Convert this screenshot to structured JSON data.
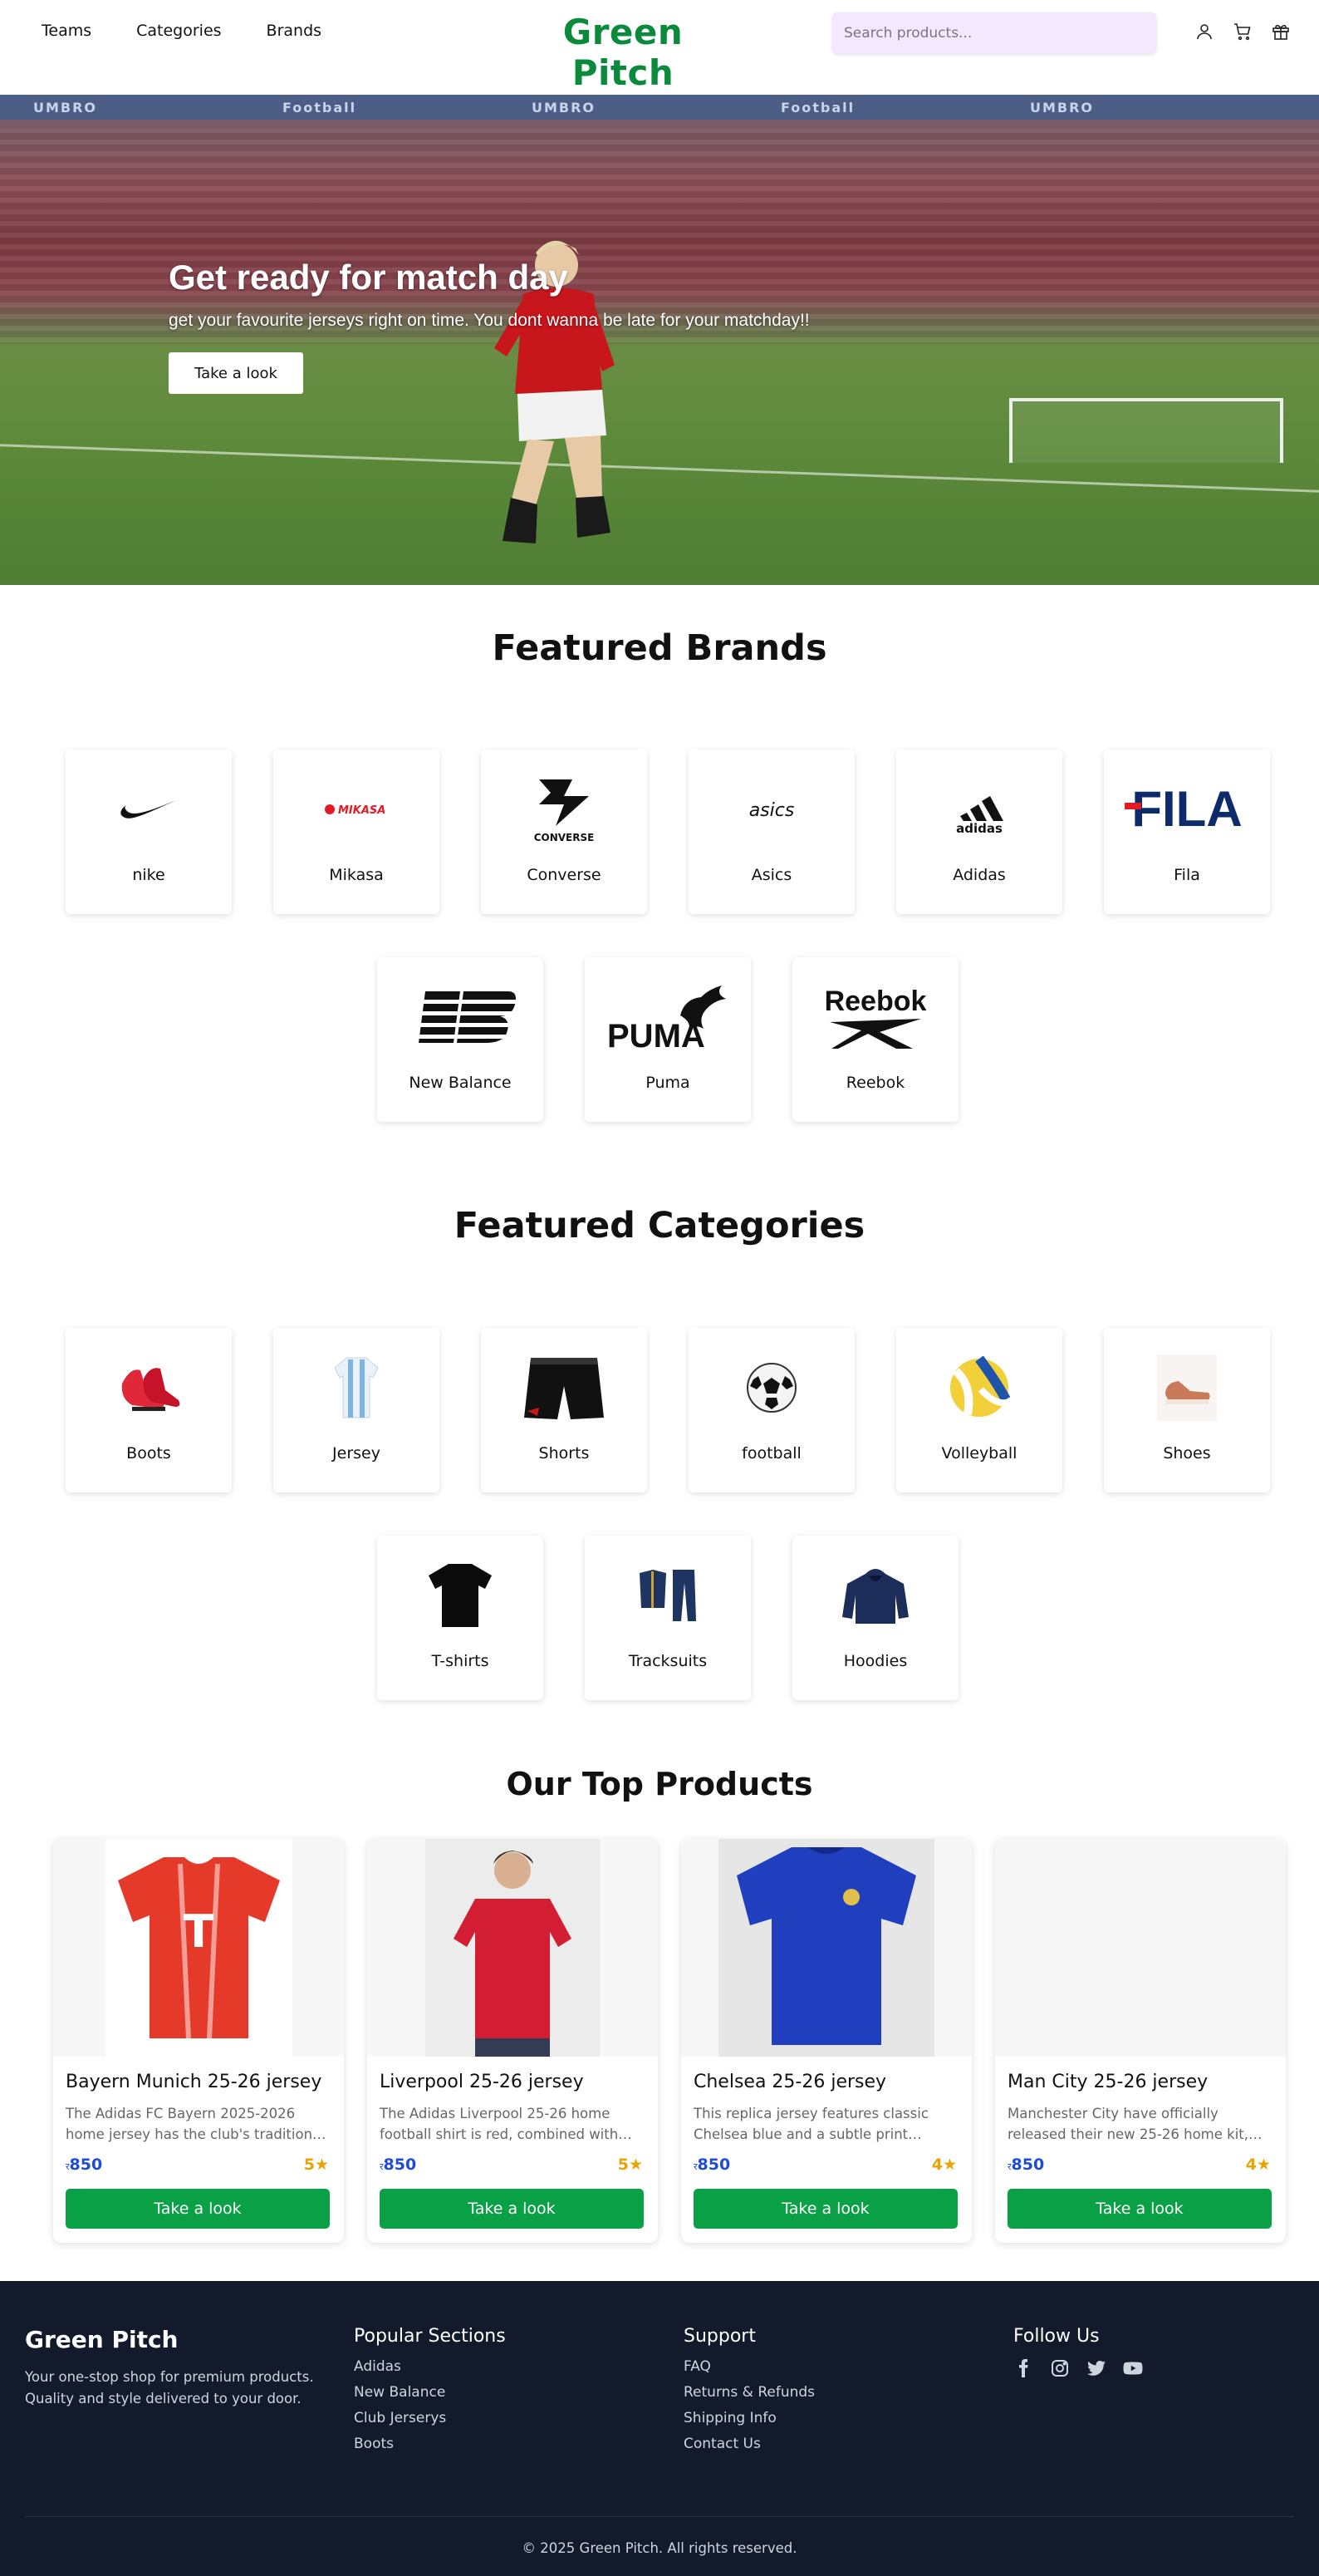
{
  "header": {
    "nav": [
      "Teams",
      "Categories",
      "Brands"
    ],
    "brand": "Green Pitch",
    "search_placeholder": "Search products...",
    "icons": [
      "user-icon",
      "cart-icon",
      "gift-icon"
    ]
  },
  "hero": {
    "title": "Get ready for match day",
    "subtitle": "get your favourite jerseys right on time. You dont wanna be late for your matchday!!",
    "button": "Take a look",
    "stand_text": [
      "UMBRO",
      "Football",
      "UMBRO",
      "Football",
      "UMBRO"
    ]
  },
  "brands": {
    "title": "Featured Brands",
    "items": [
      "nike",
      "Mikasa",
      "Converse",
      "Asics",
      "Adidas",
      "Fila",
      "New Balance",
      "Puma",
      "Reebok"
    ],
    "logos": {
      "mikasa": "MIKASA",
      "converse": "CONVERSE",
      "asics": "asics",
      "adidas": "adidas",
      "fila": "FILA",
      "puma": "PUMA",
      "reebok": "Reebok"
    }
  },
  "categories": {
    "title": "Featured Categories",
    "items": [
      "Boots",
      "Jersey",
      "Shorts",
      "football",
      "Volleyball",
      "Shoes",
      "T-shirts",
      "Tracksuits",
      "Hoodies"
    ]
  },
  "products": {
    "title": "Our Top Products",
    "items": [
      {
        "name": "Bayern Munich 25-26 jersey",
        "desc": "The Adidas FC Bayern 2025-2026 home jersey has the club's traditional colors...",
        "currency": "र",
        "price": "850",
        "rating": "5★",
        "button": "Take a look"
      },
      {
        "name": "Liverpool 25-26 jersey",
        "desc": "The Adidas Liverpool 25-26 home football shirt is red, combined with whi...",
        "currency": "र",
        "price": "850",
        "rating": "5★",
        "button": "Take a look"
      },
      {
        "name": "Chelsea 25-26 jersey",
        "desc": "This replica jersey features classic Chelsea blue and a subtle print inspire...",
        "currency": "र",
        "price": "850",
        "rating": "4★",
        "button": "Take a look"
      },
      {
        "name": "Man City 25-26 jersey",
        "desc": "Manchester City have officially released their new 25-26 home kit, which featur...",
        "currency": "र",
        "price": "850",
        "rating": "4★",
        "button": "Take a look"
      }
    ]
  },
  "footer": {
    "brand": "Green Pitch",
    "tagline": "Your one-stop shop for premium products. Quality and style delivered to your door.",
    "popular": {
      "heading": "Popular Sections",
      "links": [
        "Adidas",
        "New Balance",
        "Club Jerserys",
        "Boots"
      ]
    },
    "support": {
      "heading": "Support",
      "links": [
        "FAQ",
        "Returns & Refunds",
        "Shipping Info",
        "Contact Us"
      ]
    },
    "follow": {
      "heading": "Follow Us",
      "icons": [
        "facebook-icon",
        "instagram-icon",
        "twitter-icon",
        "youtube-icon"
      ]
    },
    "copyright": "© 2025 Green Pitch. All rights reserved."
  },
  "colors": {
    "brand_green": "#0c8a3c",
    "button_green": "#0aa146",
    "price_blue": "#1e4bd8",
    "rating_gold": "#e7a404",
    "footer_bg": "#121a2c",
    "search_bg": "#f3e8ff"
  }
}
